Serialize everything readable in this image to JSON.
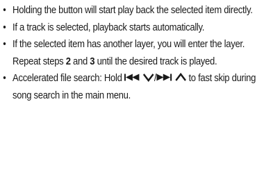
{
  "list": {
    "items": [
      {
        "text": "Holding the button will start play back the selected item directly."
      },
      {
        "text": "If a track is selected, playback starts automatically."
      },
      {
        "text_before_step2": "If the selected item has another layer, you will enter the layer. Repeat steps ",
        "step2": "2",
        "text_and": " and ",
        "step3": "3",
        "text_after": " until the desired track is played."
      },
      {
        "text_before_icons": "Accelerated file search: Hold ",
        "icon_1": "skip-back-icon",
        "icon_2": "down-chevron-icon",
        "slash": "/",
        "icon_3": "skip-forward-icon",
        "icon_4": "up-chevron-icon",
        "text_after_icons": " to fast skip during song search in the main menu."
      }
    ]
  },
  "colors": {
    "text": "#1a1a1a",
    "background": "#ffffff"
  }
}
